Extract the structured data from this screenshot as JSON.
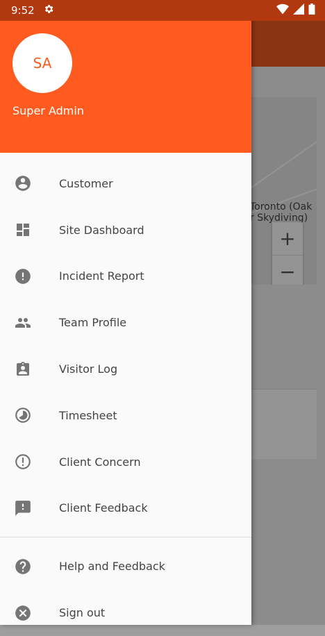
{
  "status_bar": {
    "time": "9:52",
    "icons": [
      "settings-icon",
      "wifi-icon",
      "signal-icon",
      "battery-icon"
    ]
  },
  "background_app": {
    "map_label": "Toronto (Oak\nr Skydiving)",
    "zoom_in": "+",
    "zoom_out": "−"
  },
  "drawer": {
    "avatar_initials": "SA",
    "user_name": "Super Admin",
    "menu_items": [
      {
        "label": "Customer",
        "icon": "account-circle-icon"
      },
      {
        "label": "Site Dashboard",
        "icon": "dashboard-icon"
      },
      {
        "label": "Incident Report",
        "icon": "alert-circle-icon"
      },
      {
        "label": "Team Profile",
        "icon": "people-icon"
      },
      {
        "label": "Visitor Log",
        "icon": "visitor-badge-icon"
      },
      {
        "label": "Timesheet",
        "icon": "clock-pie-icon"
      },
      {
        "label": "Client Concern",
        "icon": "alert-outline-icon"
      },
      {
        "label": "Client Feedback",
        "icon": "feedback-icon"
      }
    ],
    "secondary_items": [
      {
        "label": "Help and Feedback",
        "icon": "help-circle-icon"
      },
      {
        "label": "Sign out",
        "icon": "cancel-circle-icon"
      }
    ]
  },
  "colors": {
    "accent": "#FF5A1F",
    "status_bar": "#B2380F",
    "icon_grey": "#757575",
    "text": "#444444"
  }
}
